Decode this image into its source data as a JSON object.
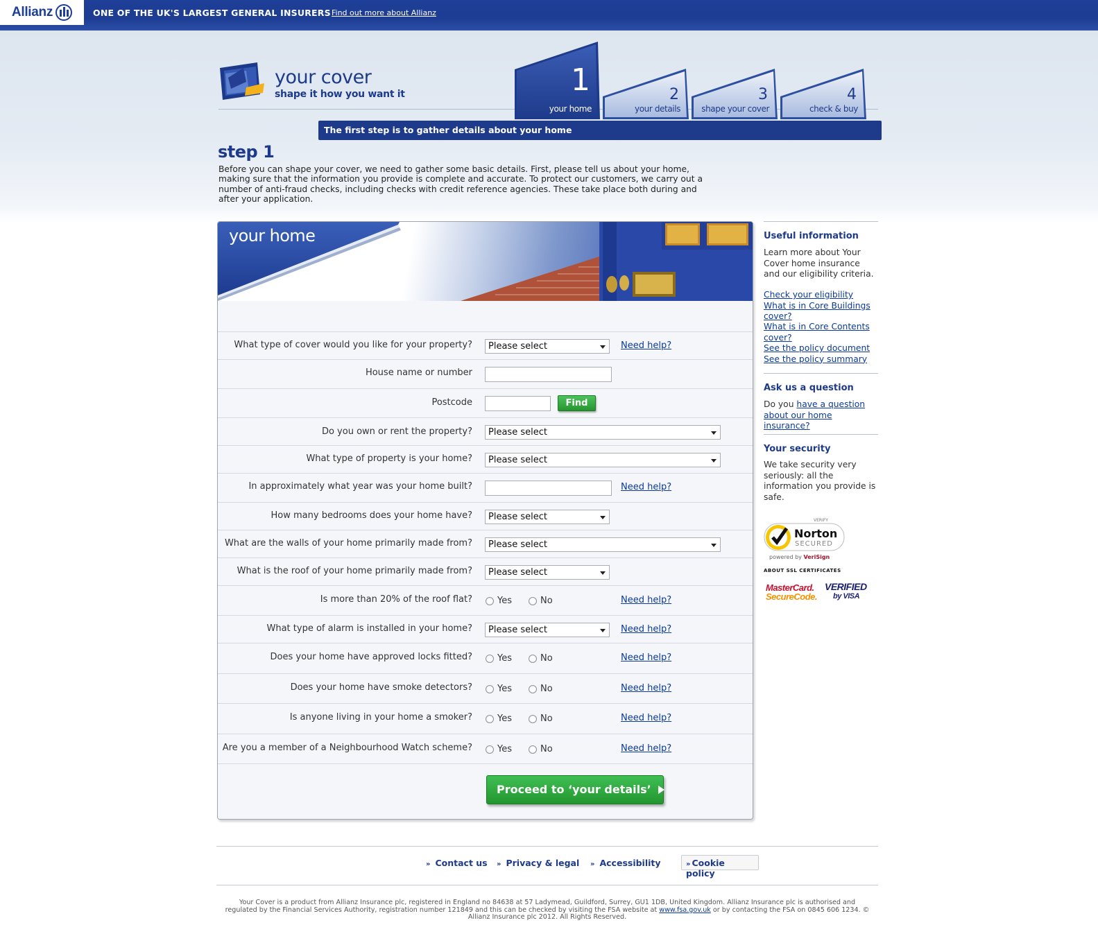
{
  "topbar": {
    "logo": "Allianz",
    "tagline": "ONE OF THE UK'S LARGEST GENERAL INSURERS",
    "link": "Find out more about Allianz"
  },
  "brand": {
    "title": "your cover",
    "subtitle": "shape it how you want it"
  },
  "tabs": [
    {
      "num": "1",
      "label": "your home",
      "active": true
    },
    {
      "num": "2",
      "label": "your details",
      "active": false
    },
    {
      "num": "3",
      "label": "shape your cover",
      "active": false
    },
    {
      "num": "4",
      "label": "check & buy",
      "active": false
    }
  ],
  "step_bar": "The first step is to gather details about your home",
  "step": {
    "title": "step 1",
    "intro": "Before you can shape your cover, we need to gather some basic details. First, please tell us about your home, making sure that the information you provide is complete and accurate. To protect our customers, we carry out a number of anti-fraud checks, including checks with credit reference agencies. These take place both during and after your application."
  },
  "form": {
    "banner_title": "your home",
    "help_label": "Need help?",
    "select_default": "Please select",
    "yes": "Yes",
    "no": "No",
    "find_button": "Find",
    "proceed_button": "Proceed to ‘your details’",
    "questions": {
      "cover_type": "What type of cover would you like for your property?",
      "house_name": "House name or number",
      "postcode": "Postcode",
      "own_rent": "Do you own or rent the property?",
      "property_type": "What type of property is your home?",
      "year_built": "In approximately what year was your home built?",
      "bedrooms": "How many bedrooms does your home have?",
      "walls": "What are the walls of your home primarily made from?",
      "roof": "What is the roof of your home primarily made from?",
      "roof_flat": "Is more than 20% of the roof flat?",
      "alarm": "What type of alarm is installed in your home?",
      "locks": "Does your home have approved locks fitted?",
      "smoke": "Does your home have smoke detectors?",
      "smoker": "Is anyone living in your home a smoker?",
      "watch": "Are you a member of a Neighbourhood Watch scheme?"
    }
  },
  "sidebar": {
    "useful_title": "Useful information",
    "useful_text": "Learn more about Your Cover home insurance and our eligibility criteria.",
    "links": [
      "Check your eligibility",
      "What is in Core Buildings cover?",
      "What is in Core Contents cover?",
      "See the policy document",
      "See the policy summary"
    ],
    "ask_title": "Ask us a question",
    "ask_prefix": "Do you",
    "ask_link": "have a question about our home insurance?",
    "security_title": "Your security",
    "security_text": "We take security very seriously: all the information you provide is safe.",
    "norton_verify": "VERIFY",
    "norton_name": "Norton",
    "norton_secured": "SECURED",
    "norton_powered": "powered by",
    "norton_verisign": "VeriSign",
    "ssl_label": "ABOUT SSL CERTIFICATES",
    "mastercard_1": "MasterCard.",
    "mastercard_2": "SecureCode.",
    "visa_1": "VERIFIED",
    "visa_2": "by VISA"
  },
  "footer": {
    "links": [
      "Contact us",
      "Privacy & legal",
      "Accessibility"
    ],
    "cookie": "Cookie policy",
    "legal_1": "Your Cover is a product from Allianz Insurance plc, registered in England no 84638 at 57 Ladymead, Guildford, Surrey, GU1 1DB, United Kingdom. Allianz Insurance plc is authorised and regulated by the Financial Services Authority, registration number 121849 and this can be checked by visiting the FSA website at",
    "legal_link": "www.fsa.gov.uk",
    "legal_2": "or by contacting the FSA on 0845 606 1234. © Allianz Insurance plc 2012. All Rights Reserved."
  }
}
